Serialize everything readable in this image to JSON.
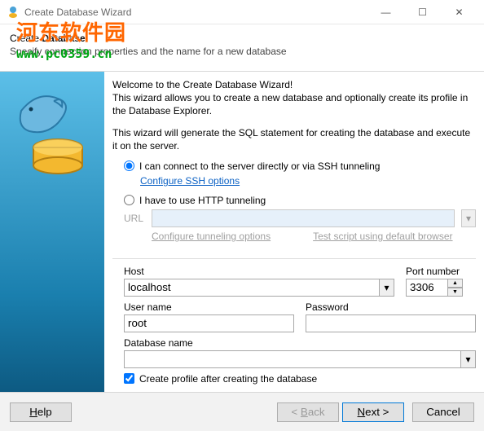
{
  "window": {
    "title": "Create Database Wizard",
    "minimize": "—",
    "maximize": "☐",
    "close": "✕"
  },
  "header": {
    "prefix": "Create ",
    "bold": "Database",
    "subtitle": "Specify connection properties and the name for a new database"
  },
  "welcome": {
    "line1": "Welcome to the Create Database Wizard!",
    "line2": "This wizard allows you to create a new database and optionally create its profile in the Database Explorer.",
    "line3": "This wizard will generate the SQL statement for creating the database and execute it on the server."
  },
  "options": {
    "direct": "I can connect to the server directly or via SSH tunneling",
    "ssh_link": "Configure SSH options",
    "http": "I have to use HTTP tunneling",
    "url_label": "URL",
    "url_value": "",
    "tunnel_link": "Configure tunneling options",
    "test_link": "Test script using default browser"
  },
  "fields": {
    "host_label": "Host",
    "host_value": "localhost",
    "port_label": "Port number",
    "port_value": "3306",
    "user_label": "User name",
    "user_value": "root",
    "pass_label": "Password",
    "pass_value": "",
    "db_label": "Database name",
    "db_value": ""
  },
  "checkbox": {
    "label": "Create profile after creating the database"
  },
  "footer": {
    "help": "Help",
    "back": "< Back",
    "next": "Next >",
    "cancel": "Cancel"
  },
  "watermark": {
    "line1": "河东软件园",
    "line2": "www.pc0359.cn"
  }
}
